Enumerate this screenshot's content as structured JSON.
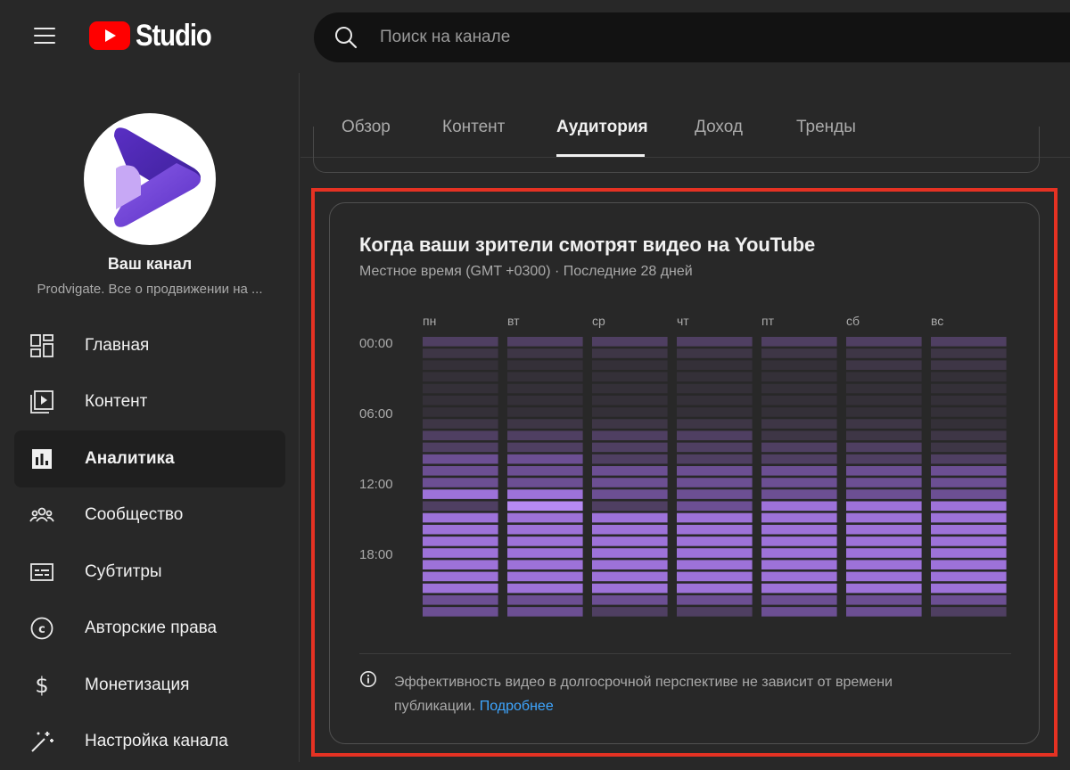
{
  "app": {
    "logo_text": "Studio",
    "brand_color": "#ff0000"
  },
  "search": {
    "placeholder": "Поиск на канале"
  },
  "channel": {
    "name": "Ваш канал",
    "description": "Prodvigate. Все о продвижении на ..."
  },
  "sidebar": {
    "items": [
      {
        "label": "Главная",
        "icon": "dashboard-icon",
        "active": false
      },
      {
        "label": "Контент",
        "icon": "content-icon",
        "active": false
      },
      {
        "label": "Аналитика",
        "icon": "analytics-icon",
        "active": true
      },
      {
        "label": "Сообщество",
        "icon": "community-icon",
        "active": false
      },
      {
        "label": "Субтитры",
        "icon": "subtitles-icon",
        "active": false
      },
      {
        "label": "Авторские права",
        "icon": "copyright-icon",
        "active": false
      },
      {
        "label": "Монетизация",
        "icon": "dollar-icon",
        "active": false
      },
      {
        "label": "Настройка канала",
        "icon": "magic-wand-icon",
        "active": false
      }
    ]
  },
  "tabs": [
    {
      "label": "Обзор",
      "active": false
    },
    {
      "label": "Контент",
      "active": false
    },
    {
      "label": "Аудитория",
      "active": true
    },
    {
      "label": "Доход",
      "active": false
    },
    {
      "label": "Тренды",
      "active": false
    }
  ],
  "card": {
    "title": "Когда ваши зрители смотрят видео на YouTube",
    "subtitle": "Местное время (GMT +0300) · Последние 28 дней",
    "footer_text": "Эффективность видео в долгосрочной перспективе не зависит от времени публикации.",
    "footer_link": "Подробнее"
  },
  "chart_data": {
    "type": "heatmap",
    "days": [
      "пн",
      "вт",
      "ср",
      "чт",
      "пт",
      "сб",
      "вс"
    ],
    "hour_labels": [
      "00:00",
      "06:00",
      "12:00",
      "18:00"
    ],
    "hours": 24,
    "scale": "relative intensity 0-5",
    "values": [
      [
        3,
        3,
        3,
        3,
        3,
        3,
        3
      ],
      [
        2,
        2,
        2,
        2,
        2,
        2,
        2
      ],
      [
        1,
        1,
        1,
        1,
        1,
        2,
        2
      ],
      [
        1,
        1,
        1,
        1,
        1,
        1,
        1
      ],
      [
        1,
        1,
        1,
        1,
        1,
        1,
        1
      ],
      [
        1,
        1,
        1,
        1,
        1,
        1,
        1
      ],
      [
        1,
        1,
        1,
        1,
        1,
        1,
        1
      ],
      [
        2,
        2,
        2,
        2,
        2,
        2,
        1
      ],
      [
        3,
        3,
        3,
        3,
        2,
        2,
        2
      ],
      [
        3,
        3,
        3,
        3,
        3,
        3,
        2
      ],
      [
        4,
        4,
        3,
        3,
        3,
        3,
        3
      ],
      [
        4,
        4,
        4,
        4,
        4,
        4,
        4
      ],
      [
        4,
        4,
        4,
        4,
        4,
        4,
        4
      ],
      [
        5,
        5,
        4,
        4,
        4,
        4,
        4
      ],
      [
        3,
        6,
        3,
        4,
        5,
        5,
        5
      ],
      [
        5,
        5,
        5,
        5,
        5,
        5,
        5
      ],
      [
        5,
        5,
        5,
        5,
        5,
        5,
        5
      ],
      [
        5,
        5,
        5,
        5,
        5,
        5,
        5
      ],
      [
        5,
        5,
        5,
        5,
        5,
        5,
        5
      ],
      [
        5,
        5,
        5,
        5,
        5,
        5,
        5
      ],
      [
        5,
        5,
        5,
        5,
        5,
        5,
        5
      ],
      [
        5,
        5,
        5,
        5,
        5,
        5,
        5
      ],
      [
        4,
        4,
        4,
        4,
        4,
        4,
        4
      ],
      [
        4,
        4,
        3,
        3,
        4,
        4,
        3
      ]
    ]
  }
}
